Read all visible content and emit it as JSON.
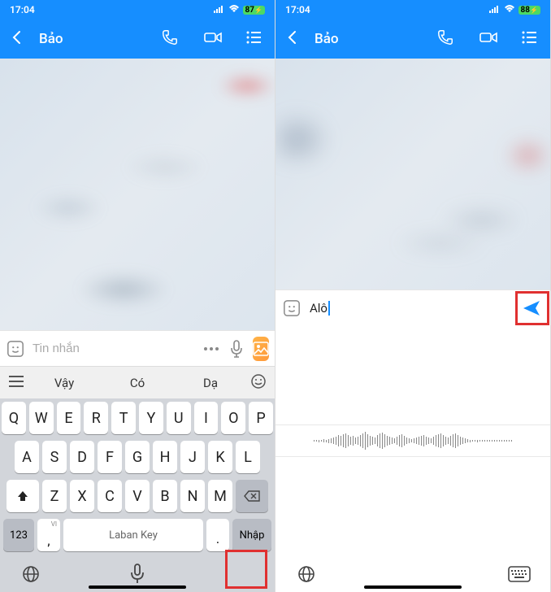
{
  "left": {
    "status": {
      "time": "17:04",
      "battery": "87"
    },
    "header": {
      "name": "Bảo"
    },
    "input": {
      "placeholder": "Tin nhắn"
    },
    "suggestions": {
      "w1": "Vậy",
      "w2": "Có",
      "w3": "Dạ"
    },
    "keyboard": {
      "row1": [
        "Q",
        "W",
        "E",
        "R",
        "T",
        "Y",
        "U",
        "I",
        "O",
        "P"
      ],
      "row2": [
        "A",
        "S",
        "D",
        "F",
        "G",
        "H",
        "J",
        "K",
        "L"
      ],
      "row3": [
        "Z",
        "X",
        "C",
        "V",
        "B",
        "N",
        "M"
      ],
      "numkey": "123",
      "comma_sup": "VI",
      "spacebar": "Laban Key",
      "enter": "Nhập"
    }
  },
  "right": {
    "status": {
      "time": "17:04",
      "battery": "88"
    },
    "header": {
      "name": "Bảo"
    },
    "input": {
      "text": "Alô"
    }
  }
}
